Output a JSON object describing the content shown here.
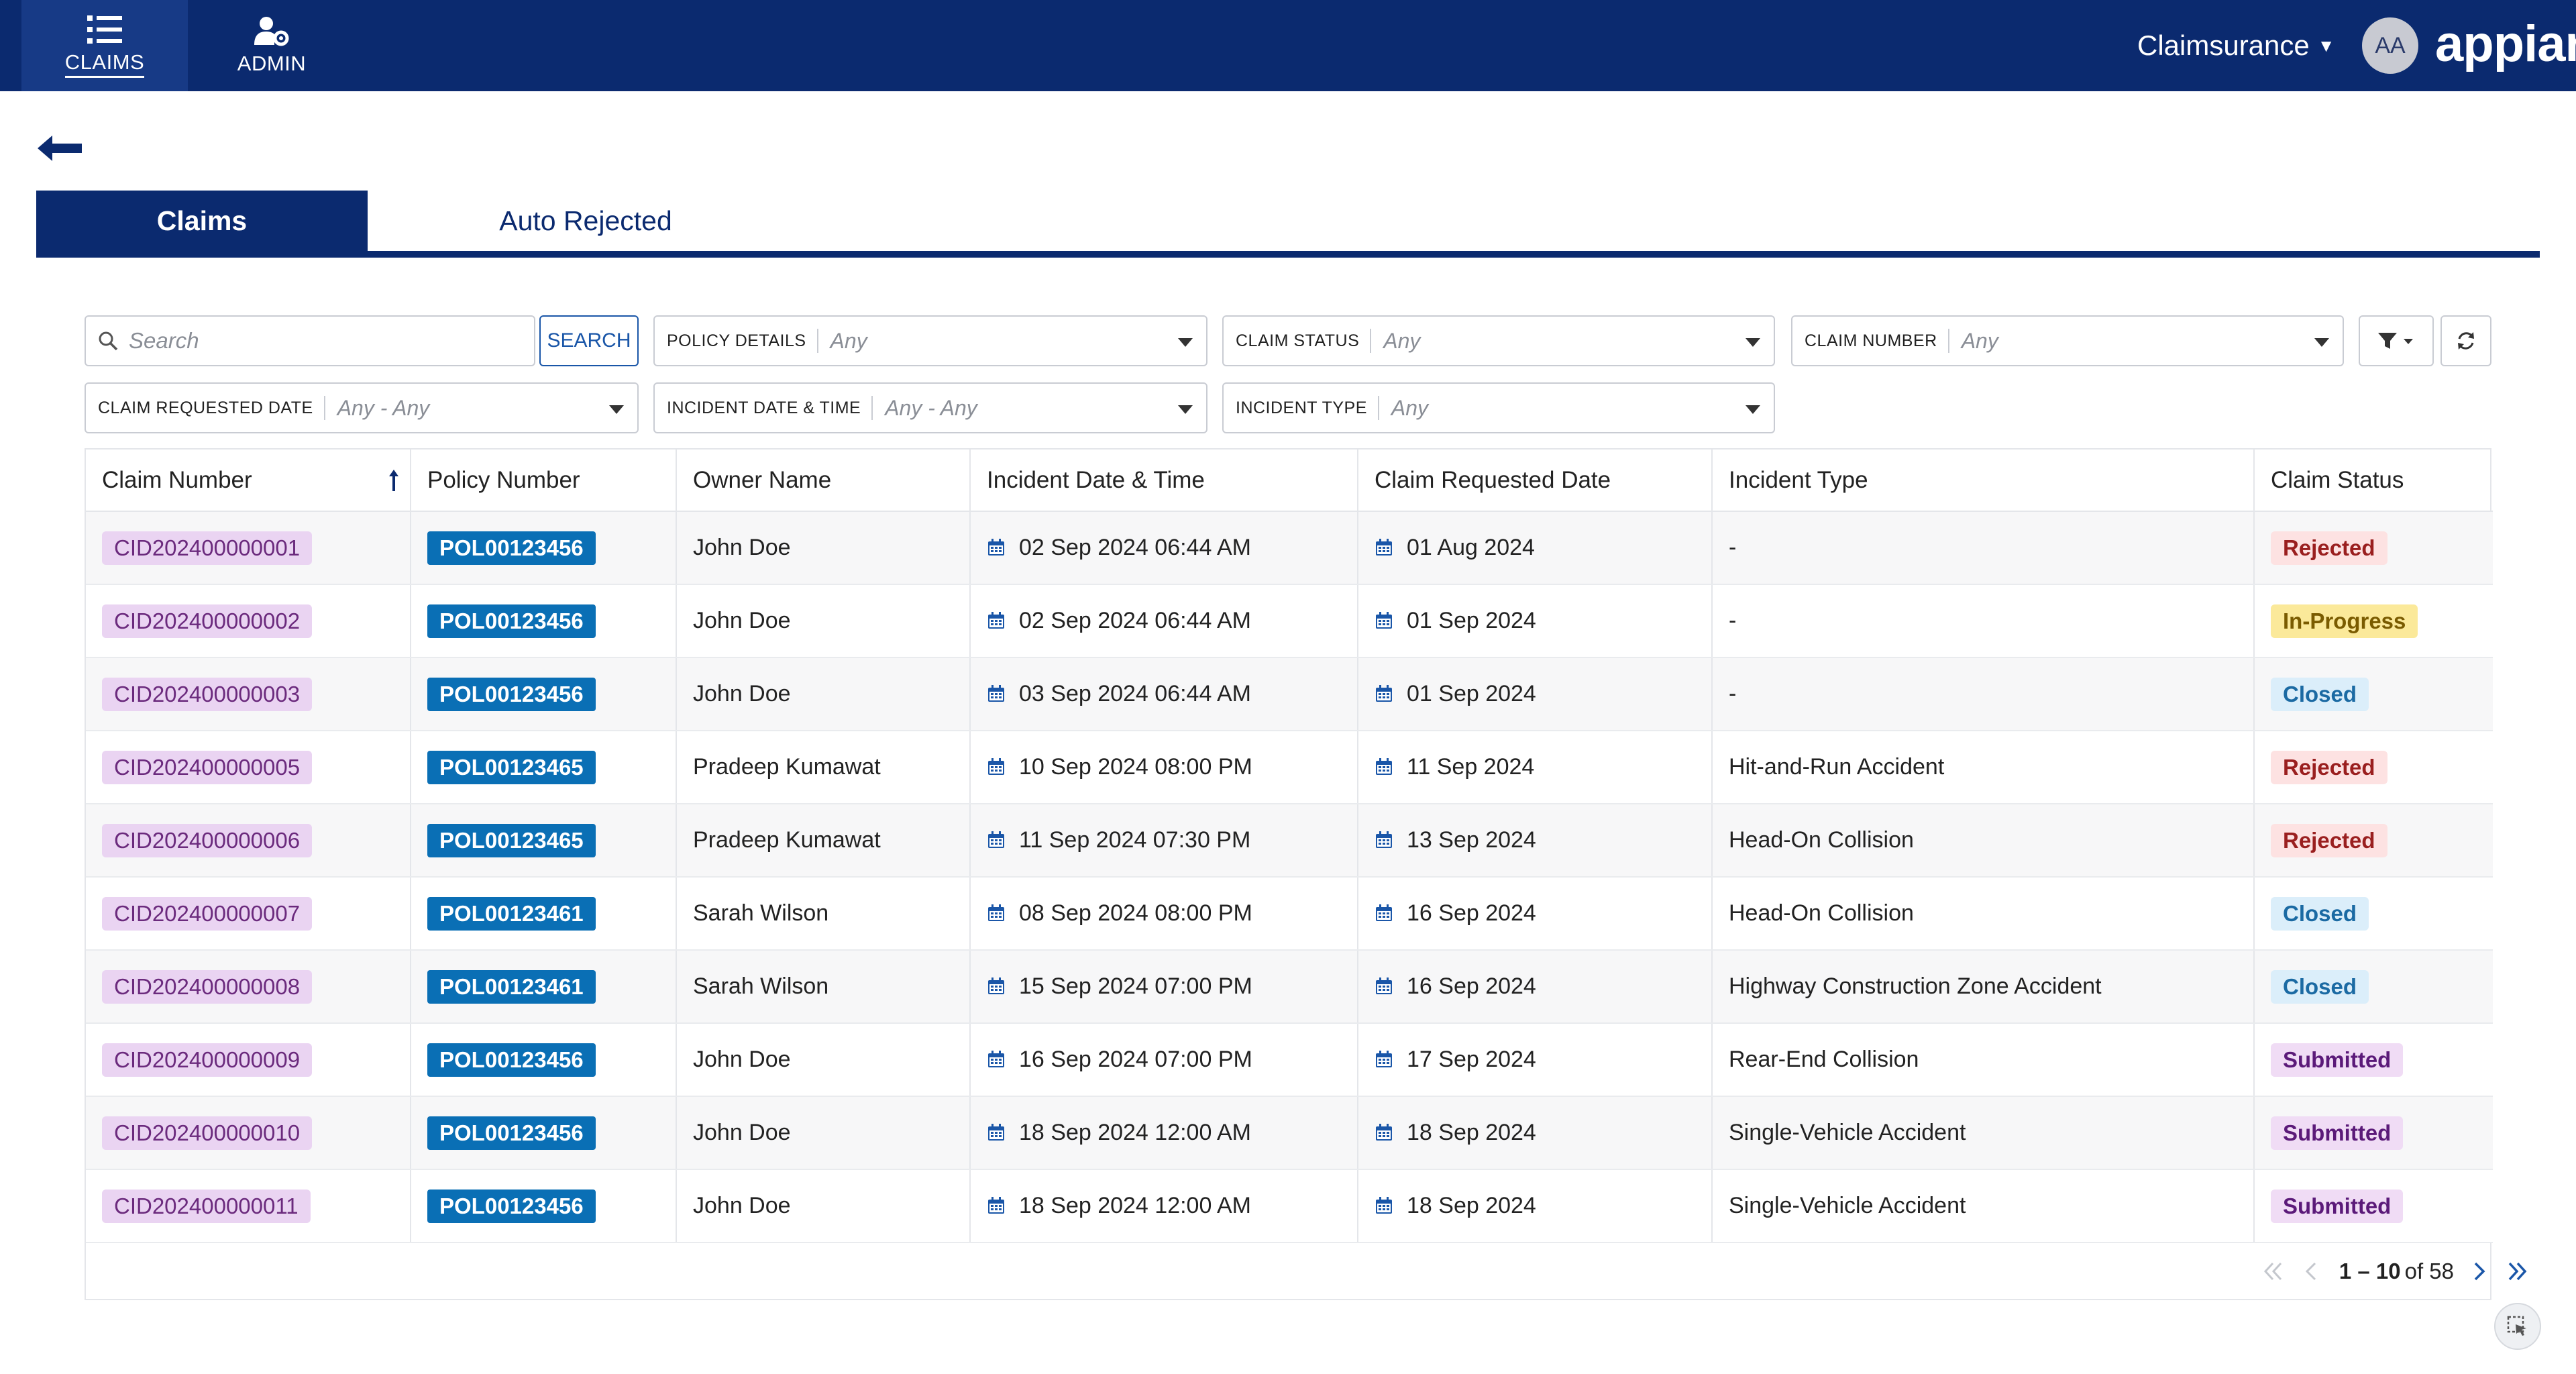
{
  "nav": {
    "items": [
      {
        "label": "CLAIMS",
        "icon": "list-icon"
      },
      {
        "label": "ADMIN",
        "icon": "user-gear-icon"
      }
    ],
    "site_name": "Claimsurance",
    "avatar_initials": "AA",
    "logo_text": "appian"
  },
  "tabs": [
    {
      "label": "Claims",
      "active": true
    },
    {
      "label": "Auto Rejected",
      "active": false
    }
  ],
  "filters": {
    "search_placeholder": "Search",
    "search_button": "SEARCH",
    "policy_details": {
      "label": "POLICY DETAILS",
      "value": "Any"
    },
    "claim_status": {
      "label": "CLAIM STATUS",
      "value": "Any"
    },
    "claim_number": {
      "label": "CLAIM NUMBER",
      "value": "Any"
    },
    "claim_requested_date": {
      "label": "CLAIM REQUESTED DATE",
      "value": "Any - Any"
    },
    "incident_date_time": {
      "label": "INCIDENT DATE & TIME",
      "value": "Any - Any"
    },
    "incident_type": {
      "label": "INCIDENT TYPE",
      "value": "Any"
    }
  },
  "table": {
    "columns": [
      "Claim Number",
      "Policy Number",
      "Owner Name",
      "Incident Date & Time",
      "Claim Requested Date",
      "Incident Type",
      "Claim Status"
    ],
    "rows": [
      {
        "claim": "CID202400000001",
        "policy": "POL00123456",
        "owner": "John Doe",
        "incident": "02 Sep 2024 06:44 AM",
        "requested": "01 Aug 2024",
        "type": "-",
        "status": "Rejected"
      },
      {
        "claim": "CID202400000002",
        "policy": "POL00123456",
        "owner": "John Doe",
        "incident": "02 Sep 2024 06:44 AM",
        "requested": "01 Sep 2024",
        "type": "-",
        "status": "In-Progress"
      },
      {
        "claim": "CID202400000003",
        "policy": "POL00123456",
        "owner": "John Doe",
        "incident": "03 Sep 2024 06:44 AM",
        "requested": "01 Sep 2024",
        "type": "-",
        "status": "Closed"
      },
      {
        "claim": "CID202400000005",
        "policy": "POL00123465",
        "owner": "Pradeep Kumawat",
        "incident": "10 Sep 2024 08:00 PM",
        "requested": "11 Sep 2024",
        "type": "Hit-and-Run Accident",
        "status": "Rejected"
      },
      {
        "claim": "CID202400000006",
        "policy": "POL00123465",
        "owner": "Pradeep Kumawat",
        "incident": "11 Sep 2024 07:30 PM",
        "requested": "13 Sep 2024",
        "type": "Head-On Collision",
        "status": "Rejected"
      },
      {
        "claim": "CID202400000007",
        "policy": "POL00123461",
        "owner": "Sarah Wilson",
        "incident": "08 Sep 2024 08:00 PM",
        "requested": "16 Sep 2024",
        "type": "Head-On Collision",
        "status": "Closed"
      },
      {
        "claim": "CID202400000008",
        "policy": "POL00123461",
        "owner": "Sarah Wilson",
        "incident": "15 Sep 2024 07:00 PM",
        "requested": "16 Sep 2024",
        "type": "Highway Construction Zone Accident",
        "status": "Closed"
      },
      {
        "claim": "CID202400000009",
        "policy": "POL00123456",
        "owner": "John Doe",
        "incident": "16 Sep 2024 07:00 PM",
        "requested": "17 Sep 2024",
        "type": "Rear-End Collision",
        "status": "Submitted"
      },
      {
        "claim": "CID202400000010",
        "policy": "POL00123456",
        "owner": "John Doe",
        "incident": "18 Sep 2024 12:00 AM",
        "requested": "18 Sep 2024",
        "type": "Single-Vehicle Accident",
        "status": "Submitted"
      },
      {
        "claim": "CID202400000011",
        "policy": "POL00123456",
        "owner": "John Doe",
        "incident": "18 Sep 2024 12:00 AM",
        "requested": "18 Sep 2024",
        "type": "Single-Vehicle Accident",
        "status": "Submitted"
      }
    ]
  },
  "pagination": {
    "range": "1 – 10",
    "of_label": "of 58"
  },
  "colors": {
    "primary": "#0b2a6f",
    "policy_tag": "#0a6fb5",
    "claim_tag": "#ead4f2"
  }
}
